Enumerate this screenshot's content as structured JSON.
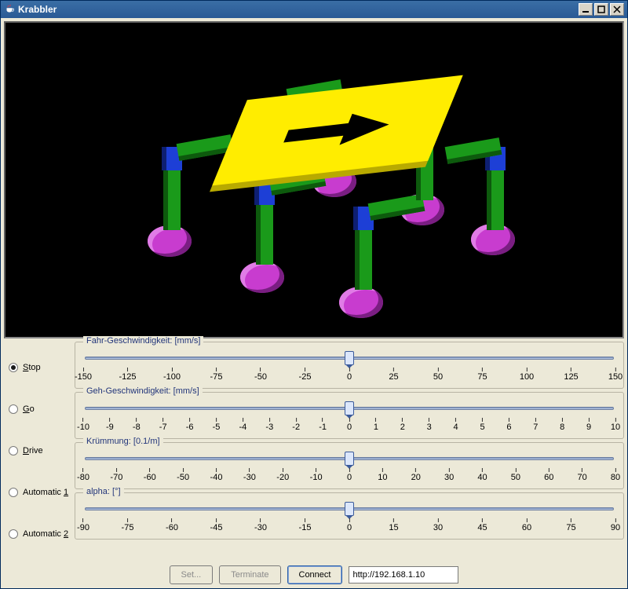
{
  "window": {
    "title": "Krabbler"
  },
  "modes": {
    "stop": {
      "label": "Stop",
      "accel": "S",
      "selected": true
    },
    "go": {
      "label": "Go",
      "accel": "G",
      "selected": false
    },
    "drive": {
      "label": "Drive",
      "accel": "D",
      "selected": false
    },
    "auto1": {
      "label": "Automatic 1",
      "accel": "1",
      "selected": false
    },
    "auto2": {
      "label": "Automatic 2",
      "accel": "2",
      "selected": false
    }
  },
  "sliders": {
    "fahr": {
      "legend": "Fahr-Geschwindigkeit: [mm/s]",
      "min": -150,
      "max": 150,
      "step": 25,
      "value": 0,
      "ticks": [
        "-150",
        "-125",
        "-100",
        "-75",
        "-50",
        "-25",
        "0",
        "25",
        "50",
        "75",
        "100",
        "125",
        "150"
      ]
    },
    "geh": {
      "legend": "Geh-Geschwindigkeit: [mm/s]",
      "min": -10,
      "max": 10,
      "step": 1,
      "value": 0,
      "ticks": [
        "-10",
        "-9",
        "-8",
        "-7",
        "-6",
        "-5",
        "-4",
        "-3",
        "-2",
        "-1",
        "0",
        "1",
        "2",
        "3",
        "4",
        "5",
        "6",
        "7",
        "8",
        "9",
        "10"
      ]
    },
    "kruem": {
      "legend": "Krümmung: [0.1/m]",
      "min": -80,
      "max": 80,
      "step": 10,
      "value": 0,
      "ticks": [
        "-80",
        "-70",
        "-60",
        "-50",
        "-40",
        "-30",
        "-20",
        "-10",
        "0",
        "10",
        "20",
        "30",
        "40",
        "50",
        "60",
        "70",
        "80"
      ]
    },
    "alpha": {
      "legend": "alpha: [°]",
      "min": -90,
      "max": 90,
      "step": 15,
      "value": 0,
      "ticks": [
        "-90",
        "-75",
        "-60",
        "-45",
        "-30",
        "-15",
        "0",
        "15",
        "30",
        "45",
        "60",
        "75",
        "90"
      ]
    }
  },
  "buttons": {
    "set": {
      "label": "Set...",
      "enabled": false
    },
    "terminate": {
      "label": "Terminate",
      "enabled": false
    },
    "connect": {
      "label": "Connect",
      "enabled": true,
      "focused": true
    }
  },
  "url": {
    "value": "http://192.168.1.10"
  },
  "colors": {
    "deck": "#ffed00",
    "leg": "#1a9a1a",
    "joint": "#1d3fd6",
    "wheel": "#c83ccf"
  },
  "icons": {
    "java": "java-cup-icon",
    "minimize": "minimize-icon",
    "maximize": "maximize-icon",
    "close": "close-icon"
  }
}
